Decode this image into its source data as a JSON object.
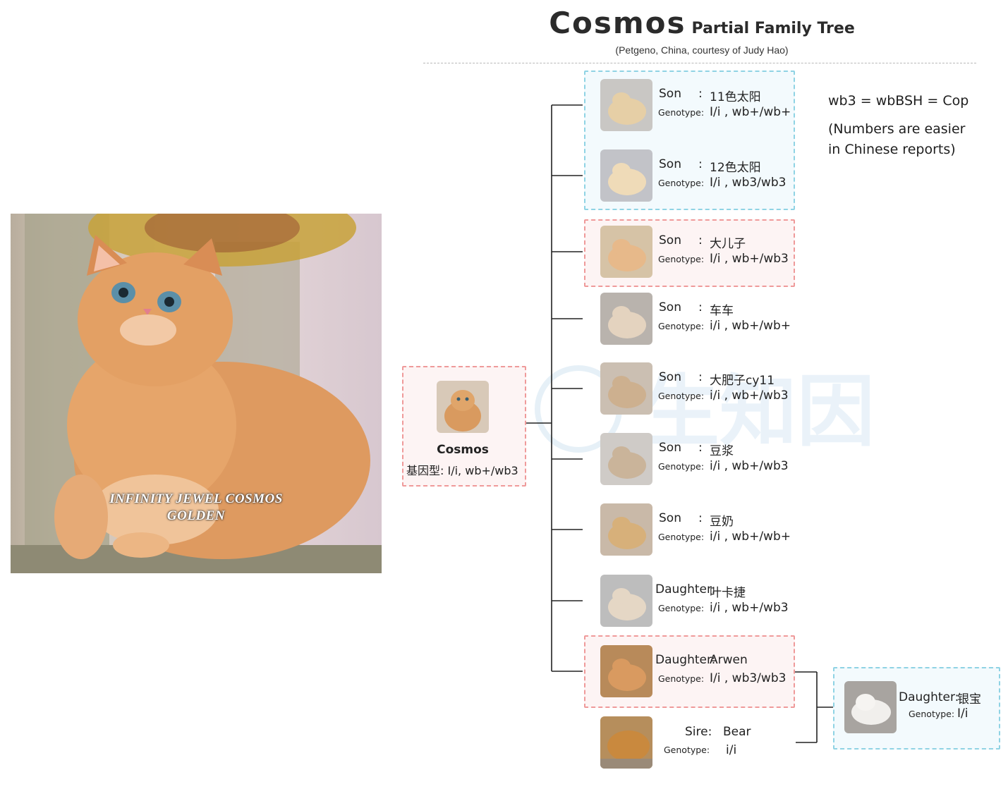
{
  "header": {
    "title_main": "Cosmos",
    "title_sub": "Partial Family Tree",
    "credit": "(Petgeno, China, courtesy of Judy Hao)"
  },
  "hero": {
    "caption_line1": "INFINITY JEWEL COSMOS",
    "caption_line2": "GOLDEN"
  },
  "notes": {
    "line1": "wb3 = wbBSH  = Cop",
    "line2": "(Numbers are easier",
    "line3": "in Chinese reports)"
  },
  "watermark": {
    "text": "生知因"
  },
  "cosmos": {
    "name": "Cosmos",
    "genotype_label": "基因型:",
    "genotype": "I/i, wb+/wb3"
  },
  "offspring": [
    {
      "role": "Son",
      "sep": ":",
      "name": "11色太阳",
      "genotype_label": "Genotype:",
      "genotype": "I/i , wb+/wb+"
    },
    {
      "role": "Son",
      "sep": ":",
      "name": "12色太阳",
      "genotype_label": "Genotype:",
      "genotype": "I/i , wb3/wb3"
    },
    {
      "role": "Son",
      "sep": ":",
      "name": "大儿子",
      "genotype_label": "Genotype:",
      "genotype": "I/i , wb+/wb3"
    },
    {
      "role": "Son",
      "sep": ":",
      "name": "车车",
      "genotype_label": "Genotype:",
      "genotype": "i/i , wb+/wb+"
    },
    {
      "role": "Son",
      "sep": ":",
      "name": "大肥子cy11",
      "genotype_label": "Genotype:",
      "genotype": "i/i , wb+/wb3"
    },
    {
      "role": "Son",
      "sep": ":",
      "name": "豆浆",
      "genotype_label": "Genotype:",
      "genotype": "i/i , wb+/wb3"
    },
    {
      "role": "Son",
      "sep": ":",
      "name": "豆奶",
      "genotype_label": "Genotype:",
      "genotype": "i/i , wb+/wb+"
    },
    {
      "role": "Daughter:",
      "sep": "",
      "name": "叶卡捷",
      "genotype_label": "Genotype:",
      "genotype": "i/i , wb+/wb3"
    },
    {
      "role": "Daughter:",
      "sep": "",
      "name": "Arwen",
      "genotype_label": "Genotype:",
      "genotype": "I/i , wb3/wb3"
    }
  ],
  "sire": {
    "role": "Sire:",
    "name": "Bear",
    "genotype_label": "Genotype:",
    "genotype": "i/i"
  },
  "granddaughter": {
    "role": "Daughter:",
    "name": "银宝",
    "genotype_label": "Genotype:",
    "genotype": "I/i"
  },
  "colors": {
    "blue_box_border": "#8fd3e4",
    "red_box_border": "#ef9a9a",
    "tree_line": "#222222"
  }
}
